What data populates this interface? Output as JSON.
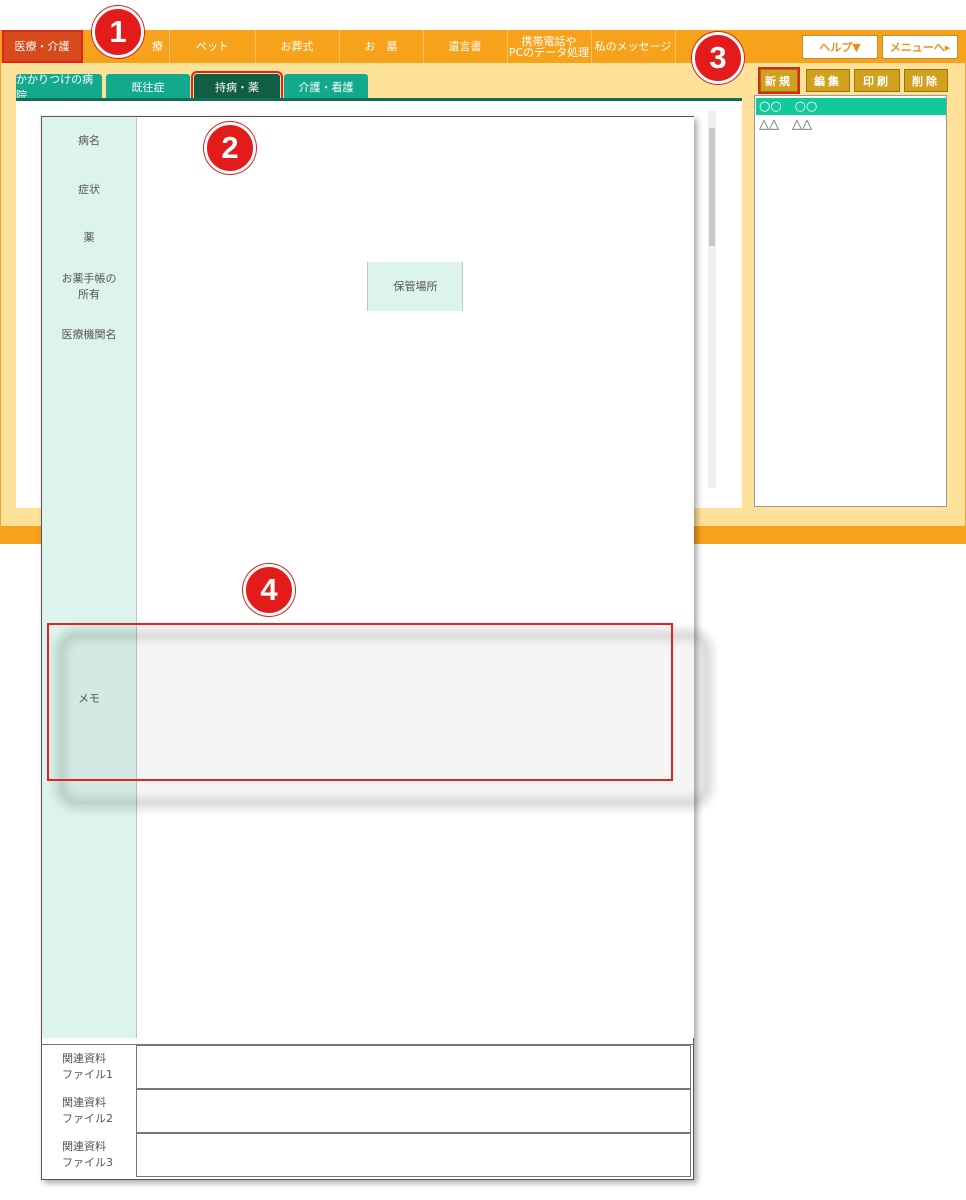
{
  "nav": {
    "items": [
      "医療・介護",
      "療",
      "ペット",
      "お葬式",
      "お　墓",
      "遺言書",
      "携帯電話や\nPCのデータ処理",
      "私のメッセージ"
    ],
    "help": "ヘルプ▼",
    "menu": "メニューへ▸"
  },
  "tabs": [
    "かかりつけの病院",
    "既往症",
    "持病・薬",
    "介護・看護"
  ],
  "actions": {
    "new": "新規",
    "edit": "編集",
    "print": "印刷",
    "delete": "削除"
  },
  "list": [
    "○○　○○",
    "△△　△△"
  ],
  "form": {
    "disease": "病名",
    "symptoms": "症状",
    "medicine": "薬",
    "notebook": "お薬手帳の\n所有",
    "storage": "保管場所",
    "institution": "医療機関名",
    "memo": "メモ",
    "files": [
      "関連資料\nファイル1",
      "関連資料\nファイル2",
      "関連資料\nファイル3"
    ]
  },
  "badges": [
    "1",
    "2",
    "3",
    "4"
  ],
  "colors": {
    "nav": "#f7a21b",
    "tab": "#12a98d",
    "tab_active": "#0f5e45",
    "label_bg": "#dcf3ee",
    "highlight": "#e1251b",
    "badge": "#e31b1b"
  }
}
